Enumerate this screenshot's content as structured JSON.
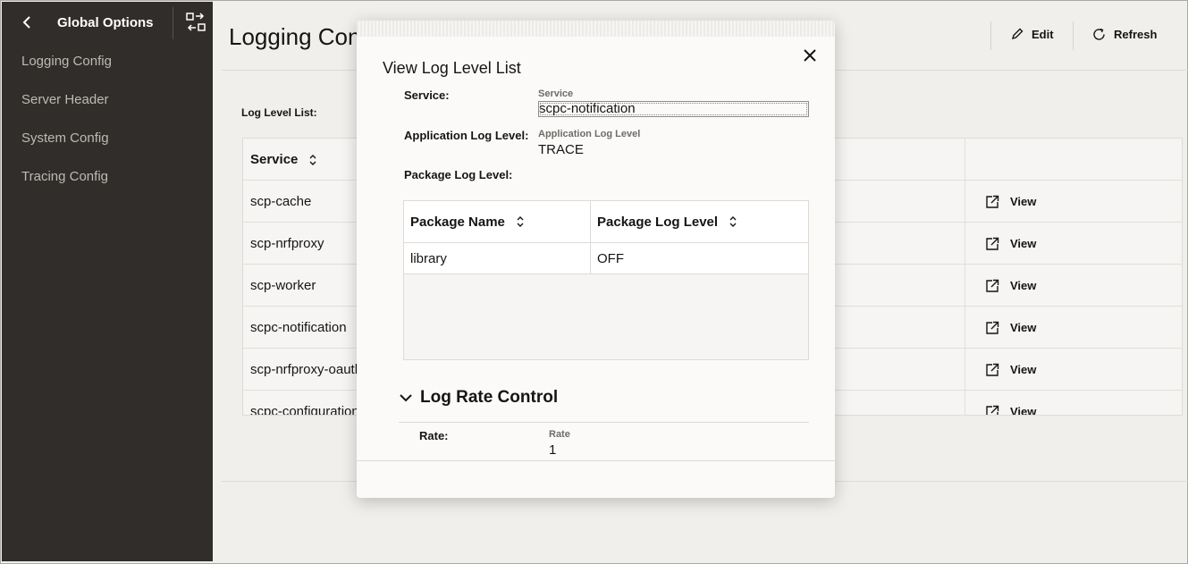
{
  "sidebar": {
    "title": "Global Options",
    "items": [
      {
        "label": "Logging Config"
      },
      {
        "label": "Server Header"
      },
      {
        "label": "System Config"
      },
      {
        "label": "Tracing Config"
      }
    ]
  },
  "header": {
    "title": "Logging Config",
    "edit_label": "Edit",
    "refresh_label": "Refresh"
  },
  "main": {
    "list_label": "Log Level List:",
    "table": {
      "column_service": "Service",
      "view_label": "View",
      "rows": [
        {
          "service": "scp-cache"
        },
        {
          "service": "scp-nrfproxy"
        },
        {
          "service": "scp-worker"
        },
        {
          "service": "scpc-notification"
        },
        {
          "service": "scp-nrfproxy-oauth"
        },
        {
          "service": "scpc-configuration"
        }
      ]
    }
  },
  "modal": {
    "title": "View Log Level List",
    "service_label": "Service:",
    "service_small": "Service",
    "service_value": "scpc-notification",
    "app_level_label": "Application Log Level:",
    "app_level_small": "Application Log Level",
    "app_level_value": "TRACE",
    "pkg_level_label": "Package Log Level:",
    "pkg_table": {
      "col_name": "Package Name",
      "col_level": "Package Log Level",
      "rows": [
        {
          "name": "library",
          "level": "OFF"
        }
      ]
    },
    "section_title": "Log Rate Control",
    "rate_label": "Rate:",
    "rate_small": "Rate",
    "rate_value": "1"
  }
}
